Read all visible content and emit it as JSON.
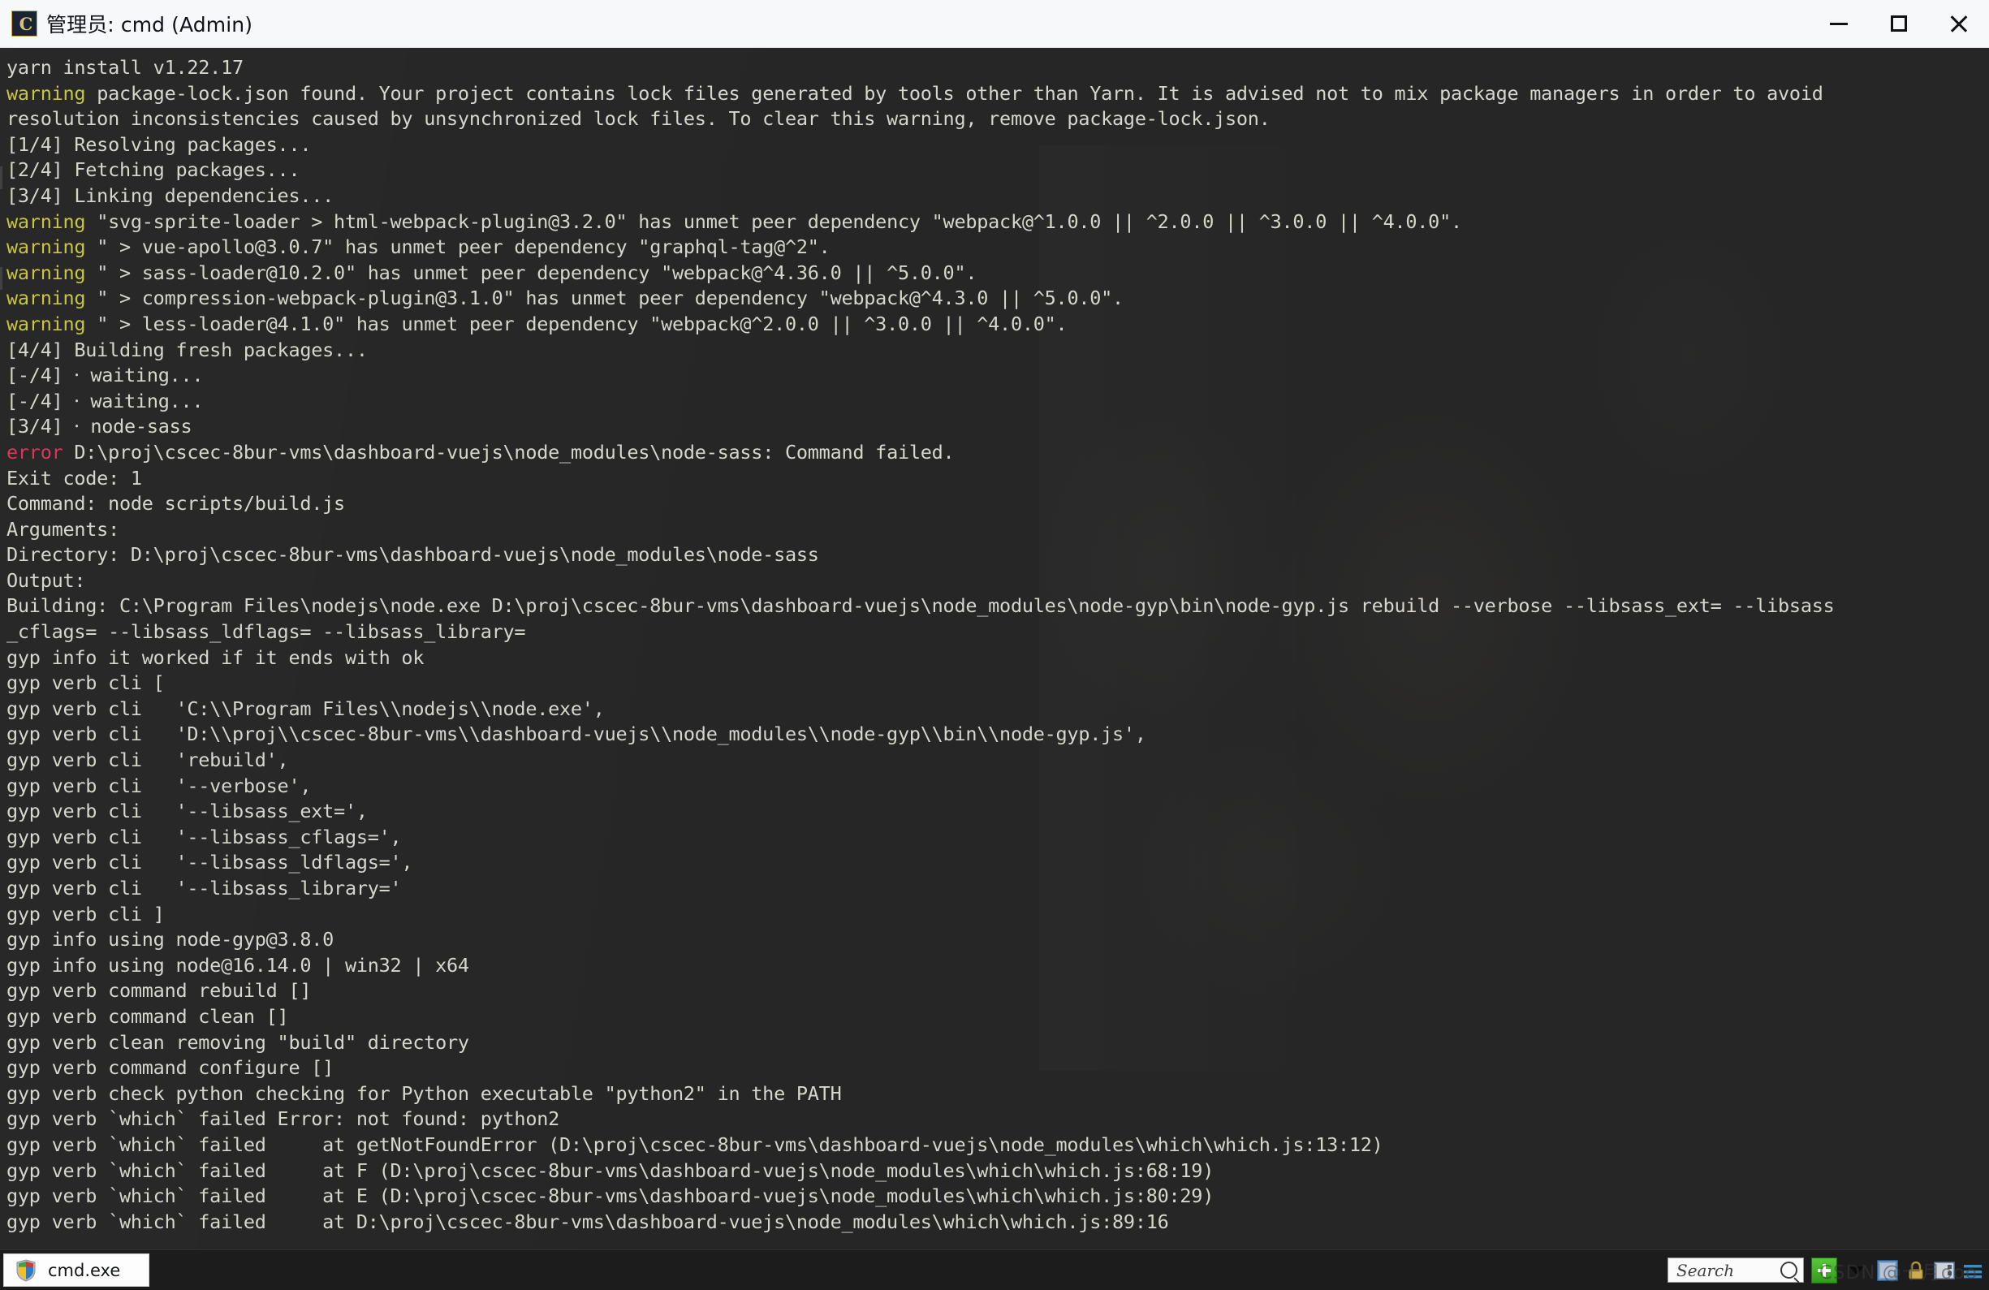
{
  "window": {
    "title": "管理员: cmd (Admin)",
    "icon_name": "cmd-console-icon",
    "icon_glyph": "C",
    "controls": {
      "minimize_label": "Minimize",
      "maximize_label": "Maximize",
      "close_label": "Close"
    }
  },
  "console": {
    "lines": [
      [
        {
          "t": "plain",
          "s": "yarn install v1.22.17"
        }
      ],
      [
        {
          "t": "warning",
          "s": "warning"
        },
        {
          "t": "plain",
          "s": " package-lock.json found. Your project contains lock files generated by tools other than Yarn. It is advised not to mix package managers in order to avoid"
        }
      ],
      [
        {
          "t": "plain",
          "s": "resolution inconsistencies caused by unsynchronized lock files. To clear this warning, remove package-lock.json."
        }
      ],
      [
        {
          "t": "plain",
          "s": "[1/4] Resolving packages..."
        }
      ],
      [
        {
          "t": "plain",
          "s": "[2/4] Fetching packages..."
        }
      ],
      [
        {
          "t": "plain",
          "s": "[3/4] Linking dependencies..."
        }
      ],
      [
        {
          "t": "warning",
          "s": "warning"
        },
        {
          "t": "plain",
          "s": " \"svg-sprite-loader > html-webpack-plugin@3.2.0\" has unmet peer dependency \"webpack@^1.0.0 || ^2.0.0 || ^3.0.0 || ^4.0.0\"."
        }
      ],
      [
        {
          "t": "warning",
          "s": "warning"
        },
        {
          "t": "plain",
          "s": " \" > vue-apollo@3.0.7\" has unmet peer dependency \"graphql-tag@^2\"."
        }
      ],
      [
        {
          "t": "warning",
          "s": "warning"
        },
        {
          "t": "plain",
          "s": " \" > sass-loader@10.2.0\" has unmet peer dependency \"webpack@^4.36.0 || ^5.0.0\"."
        }
      ],
      [
        {
          "t": "warning",
          "s": "warning"
        },
        {
          "t": "plain",
          "s": " \" > compression-webpack-plugin@3.1.0\" has unmet peer dependency \"webpack@^4.3.0 || ^5.0.0\"."
        }
      ],
      [
        {
          "t": "warning",
          "s": "warning"
        },
        {
          "t": "plain",
          "s": " \" > less-loader@4.1.0\" has unmet peer dependency \"webpack@^2.0.0 || ^3.0.0 || ^4.0.0\"."
        }
      ],
      [
        {
          "t": "plain",
          "s": "[4/4] Building fresh packages..."
        }
      ],
      [
        {
          "t": "plain",
          "s": "[-/4] ⸱ waiting..."
        }
      ],
      [
        {
          "t": "plain",
          "s": "[-/4] ⸱ waiting..."
        }
      ],
      [
        {
          "t": "plain",
          "s": "[3/4] ⸱ node-sass"
        }
      ],
      [
        {
          "t": "error",
          "s": "error"
        },
        {
          "t": "plain",
          "s": " D:\\proj\\cscec-8bur-vms\\dashboard-vuejs\\node_modules\\node-sass: Command failed."
        }
      ],
      [
        {
          "t": "plain",
          "s": "Exit code: 1"
        }
      ],
      [
        {
          "t": "plain",
          "s": "Command: node scripts/build.js"
        }
      ],
      [
        {
          "t": "plain",
          "s": "Arguments:"
        }
      ],
      [
        {
          "t": "plain",
          "s": "Directory: D:\\proj\\cscec-8bur-vms\\dashboard-vuejs\\node_modules\\node-sass"
        }
      ],
      [
        {
          "t": "plain",
          "s": "Output:"
        }
      ],
      [
        {
          "t": "plain",
          "s": "Building: C:\\Program Files\\nodejs\\node.exe D:\\proj\\cscec-8bur-vms\\dashboard-vuejs\\node_modules\\node-gyp\\bin\\node-gyp.js rebuild --verbose --libsass_ext= --libsass"
        }
      ],
      [
        {
          "t": "plain",
          "s": "_cflags= --libsass_ldflags= --libsass_library="
        }
      ],
      [
        {
          "t": "plain",
          "s": "gyp info it worked if it ends with ok"
        }
      ],
      [
        {
          "t": "plain",
          "s": "gyp verb cli ["
        }
      ],
      [
        {
          "t": "plain",
          "s": "gyp verb cli   'C:\\\\Program Files\\\\nodejs\\\\node.exe',"
        }
      ],
      [
        {
          "t": "plain",
          "s": "gyp verb cli   'D:\\\\proj\\\\cscec-8bur-vms\\\\dashboard-vuejs\\\\node_modules\\\\node-gyp\\\\bin\\\\node-gyp.js',"
        }
      ],
      [
        {
          "t": "plain",
          "s": "gyp verb cli   'rebuild',"
        }
      ],
      [
        {
          "t": "plain",
          "s": "gyp verb cli   '--verbose',"
        }
      ],
      [
        {
          "t": "plain",
          "s": "gyp verb cli   '--libsass_ext=',"
        }
      ],
      [
        {
          "t": "plain",
          "s": "gyp verb cli   '--libsass_cflags=',"
        }
      ],
      [
        {
          "t": "plain",
          "s": "gyp verb cli   '--libsass_ldflags=',"
        }
      ],
      [
        {
          "t": "plain",
          "s": "gyp verb cli   '--libsass_library='"
        }
      ],
      [
        {
          "t": "plain",
          "s": "gyp verb cli ]"
        }
      ],
      [
        {
          "t": "plain",
          "s": "gyp info using node-gyp@3.8.0"
        }
      ],
      [
        {
          "t": "plain",
          "s": "gyp info using node@16.14.0 | win32 | x64"
        }
      ],
      [
        {
          "t": "plain",
          "s": "gyp verb command rebuild []"
        }
      ],
      [
        {
          "t": "plain",
          "s": "gyp verb command clean []"
        }
      ],
      [
        {
          "t": "plain",
          "s": "gyp verb clean removing \"build\" directory"
        }
      ],
      [
        {
          "t": "plain",
          "s": "gyp verb command configure []"
        }
      ],
      [
        {
          "t": "plain",
          "s": "gyp verb check python checking for Python executable \"python2\" in the PATH"
        }
      ],
      [
        {
          "t": "plain",
          "s": "gyp verb `which` failed Error: not found: python2"
        }
      ],
      [
        {
          "t": "plain",
          "s": "gyp verb `which` failed     at getNotFoundError (D:\\proj\\cscec-8bur-vms\\dashboard-vuejs\\node_modules\\which\\which.js:13:12)"
        }
      ],
      [
        {
          "t": "plain",
          "s": "gyp verb `which` failed     at F (D:\\proj\\cscec-8bur-vms\\dashboard-vuejs\\node_modules\\which\\which.js:68:19)"
        }
      ],
      [
        {
          "t": "plain",
          "s": "gyp verb `which` failed     at E (D:\\proj\\cscec-8bur-vms\\dashboard-vuejs\\node_modules\\which\\which.js:80:29)"
        }
      ],
      [
        {
          "t": "plain",
          "s": "gyp verb `which` failed     at D:\\proj\\cscec-8bur-vms\\dashboard-vuejs\\node_modules\\which\\which.js:89:16"
        }
      ]
    ],
    "colors": {
      "background": "#262626",
      "foreground": "#d6d6cf",
      "warning": "#c9c544",
      "error": "#d9375b"
    }
  },
  "taskbar": {
    "task_button": {
      "label": "cmd.exe",
      "icon_name": "uac-shield-icon"
    },
    "search": {
      "placeholder": "Search",
      "value": "",
      "icon_name": "search-icon"
    },
    "add_button_label": "+",
    "dropdown_label": "▾",
    "tray_icons": [
      "csdn-icon",
      "lock-icon",
      "panel-icon",
      "menu-icon"
    ],
    "watermark": "CSDN @十月ooo"
  }
}
